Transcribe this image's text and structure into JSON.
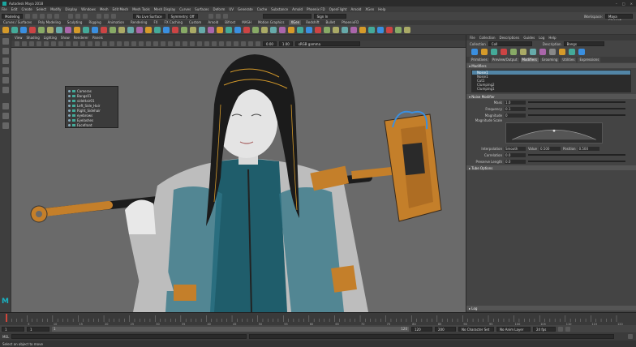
{
  "app": {
    "title": "Autodesk Maya 2018",
    "workspace_label": "Workspace:",
    "workspace_value": "Maya Classic*"
  },
  "menubar": [
    "File",
    "Edit",
    "Create",
    "Select",
    "Modify",
    "Display",
    "Windows",
    "Mesh",
    "Edit Mesh",
    "Mesh Tools",
    "Mesh Display",
    "Curves",
    "Surfaces",
    "Deform",
    "UV",
    "Generate",
    "Cache",
    "Substance",
    "Arnold",
    "Phoenix FD",
    "OpenFlight",
    "Arnold",
    "XGen",
    "Help"
  ],
  "statusline": {
    "mode": "Modeling",
    "live_surface": "No Live Surface",
    "symmetry": "Symmetry: Off",
    "sign_in": "Sign In"
  },
  "shelf_tabs": [
    "Curves / Surfaces",
    "Poly Modeling",
    "Sculpting",
    "Rigging",
    "Animation",
    "Rendering",
    "FX",
    "FX Caching",
    "Custom",
    "Arnold",
    "Bifrost",
    "MASH",
    "Motion Graphics",
    "XGen",
    "Redshift",
    "Bullet",
    "PhoenixFD"
  ],
  "shelf_active": "XGen",
  "viewport": {
    "menu": [
      "View",
      "Shading",
      "Lighting",
      "Show",
      "Renderer",
      "Panels"
    ],
    "value_a": "0.00",
    "value_b": "1.00",
    "color_space": "sRGB gamma"
  },
  "outliner": {
    "items": [
      "Cameras",
      "Bangs01",
      "sideHair01",
      "Left_Side_Hair",
      "Right_Sidehair",
      "eyebrows",
      "Eyelashes",
      "Facefront"
    ]
  },
  "xgen": {
    "menu": [
      "File",
      "Collection",
      "Descriptions",
      "Guides",
      "Log",
      "Help"
    ],
    "collection_label": "Collection",
    "collection_value": "Coll",
    "description_label": "Description",
    "description_value": "Bangs",
    "tabs": [
      "Primitives",
      "Preview/Output",
      "Modifiers",
      "Grooming",
      "Utilities",
      "Expressions"
    ],
    "active_tab": "Modifiers",
    "modifiers_section": "Modifiers",
    "modifier_list": [
      "Noise1",
      "Noise1",
      "Cut1",
      "Clumping2",
      "Clumping1"
    ],
    "noise_section": "Noise Modifier",
    "attrs": [
      {
        "label": "Mask",
        "value": "1.0"
      },
      {
        "label": "Frequency",
        "value": "0.1"
      },
      {
        "label": "Magnitude",
        "value": "0"
      }
    ],
    "magnitude_scale_label": "Magnitude Scale",
    "interp_label": "Interpolation",
    "interp_value": "Smooth",
    "interp_value_label": "Value",
    "interp_value_value": "0.500",
    "interp_pos_label": "Position",
    "interp_pos_value": "0.500",
    "correlation_label": "Correlation",
    "correlation_value": "0.0",
    "preserve_label": "Preserve Length",
    "preserve_value": "0.0",
    "tube_section": "Tube Options",
    "log_label": "Log"
  },
  "timeline": {
    "ticks": [
      "5",
      "10",
      "15",
      "20",
      "25",
      "30",
      "35",
      "40",
      "45",
      "50",
      "55",
      "60",
      "65",
      "70",
      "75",
      "80",
      "85",
      "90",
      "95",
      "100",
      "105",
      "110",
      "115",
      "120"
    ],
    "current_frame": "1"
  },
  "range": {
    "start": "1",
    "inner_start": "1",
    "inner_end": "120",
    "end": "120",
    "end2": "200",
    "character": "No Character Set",
    "anim_layer": "No Anim Layer",
    "fps": "24 fps"
  },
  "command_line": {
    "label": "MEL"
  },
  "help_line": "Select an object to move"
}
